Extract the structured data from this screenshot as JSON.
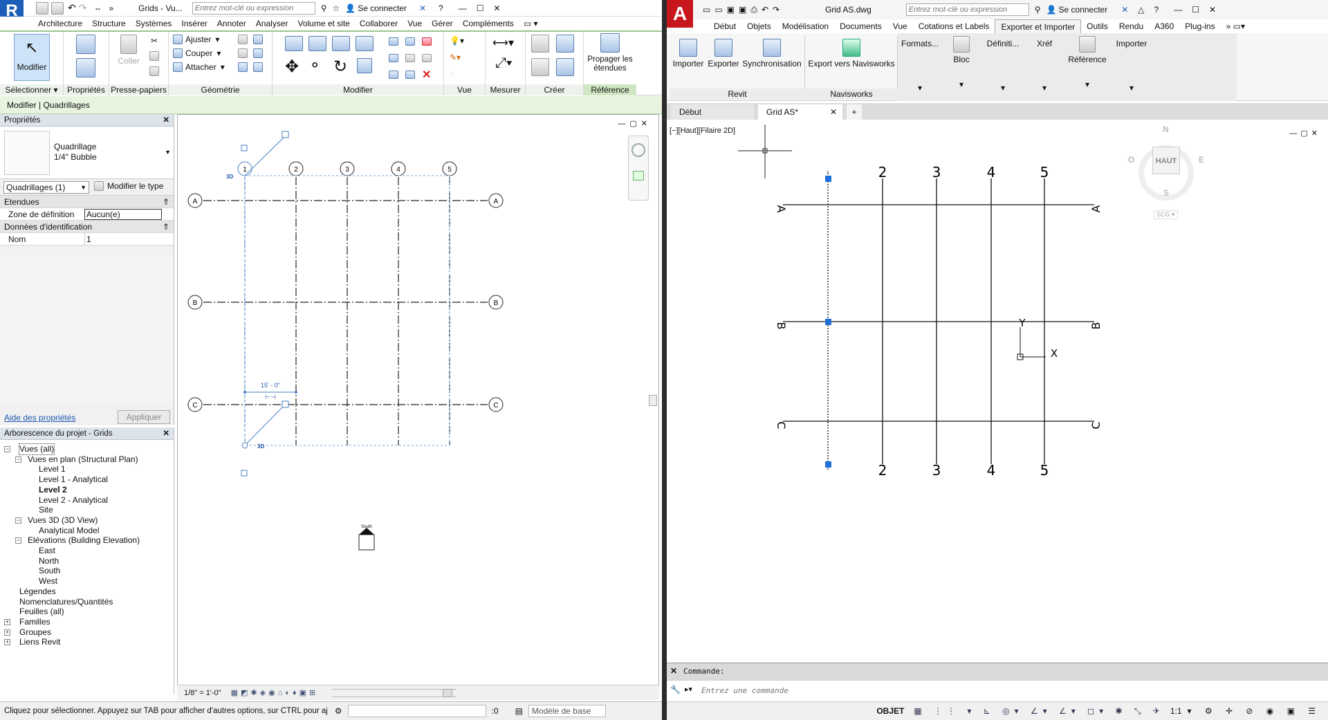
{
  "revit": {
    "title": "Grids - Vu...",
    "search_placeholder": "Entrez mot-clé ou expression",
    "signin": "Se connecter",
    "menu": [
      "Architecture",
      "Structure",
      "Systèmes",
      "Insérer",
      "Annoter",
      "Analyser",
      "Volume et site",
      "Collaborer",
      "Vue",
      "Gérer",
      "Compléments",
      "Modifier | Quadrillages"
    ],
    "ribbon": {
      "modifier": "Modifier",
      "proprietes": "Propriétés",
      "coller": "Coller",
      "ajuster": "Ajuster",
      "couper": "Couper",
      "attacher": "Attacher",
      "propager": "Propager les étendues",
      "groups": [
        "Sélectionner",
        "Propriétés",
        "Presse-papiers",
        "Géométrie",
        "Modifier",
        "Vue",
        "Mesurer",
        "Créer",
        "Référence"
      ]
    },
    "context_bar": "Modifier | Quadrillages",
    "properties": {
      "title": "Propriétés",
      "family": "Quadrillage",
      "type": "1/4\" Bubble",
      "selector": "Quadrillages (1)",
      "edit_type": "Modifier le type",
      "section_extents": "Etendues",
      "zone_label": "Zone de définition",
      "zone_value": "Aucun(e)",
      "section_id": "Données d'identification",
      "name_label": "Nom",
      "name_value": "1",
      "help_link": "Aide des propriétés",
      "apply": "Appliquer"
    },
    "browser": {
      "title": "Arborescence du projet - Grids",
      "nodes": [
        "Vues (all)",
        "Vues en plan (Structural Plan)",
        "Level 1",
        "Level 1 - Analytical",
        "Level 2",
        "Level 2 - Analytical",
        "Site",
        "Vues 3D (3D View)",
        "Analytical Model",
        "Elévations (Building Elevation)",
        "East",
        "North",
        "South",
        "West",
        "Légendes",
        "Nomenclatures/Quantités",
        "Feuilles (all)",
        "Familles",
        "Groupes",
        "Liens Revit"
      ]
    },
    "canvas": {
      "grid_cols": [
        "1",
        "2",
        "3",
        "4",
        "5"
      ],
      "grid_rows": [
        "A",
        "B",
        "C"
      ],
      "label_3d": "3D",
      "dimension": "15' - 0\"",
      "south_label": "South"
    },
    "scale": "1/8\" = 1'-0\"",
    "status": "Cliquez pour sélectionner. Appuyez sur TAB pour afficher d'autres options, sur CTRL pour aj",
    "status_zero": ":0",
    "model": "Modèle de base"
  },
  "autocad": {
    "title": "Grid AS.dwg",
    "search_placeholder": "Entrez mot-clé ou expression",
    "signin": "Se connecter",
    "menu": [
      "Début",
      "Objets",
      "Modélisation",
      "Documents",
      "Vue",
      "Cotations et Labels",
      "Exporter et Importer",
      "Outils",
      "Rendu",
      "A360",
      "Plug-ins"
    ],
    "ribbon": {
      "importer": "Importer",
      "exporter": "Exporter",
      "sync": "Synchronisation",
      "navis": "Export vers Navisworks",
      "formats": "Formats...",
      "bloc": "Bloc",
      "definiti": "Définiti...",
      "xref": "Xréf",
      "reference": "Référence",
      "importer2": "Importer",
      "group_revit": "Revit",
      "group_navis": "Navisworks"
    },
    "tabs": [
      "Début",
      "Grid AS*"
    ],
    "viewport_label": "[−][Haut][Filaire 2D]",
    "viewcube": {
      "n": "N",
      "s": "S",
      "e": "E",
      "w": "O",
      "top": "HAUT",
      "ucs": "SCG"
    },
    "grid_cols": [
      "1",
      "2",
      "3",
      "4",
      "5"
    ],
    "grid_rows": [
      "A",
      "B",
      "C"
    ],
    "ucs_x": "X",
    "ucs_y": "Y",
    "cmd_label": "Commande:",
    "cmd_placeholder": "Entrez une commande",
    "status_objet": "OBJET",
    "status_scale": "1:1"
  }
}
